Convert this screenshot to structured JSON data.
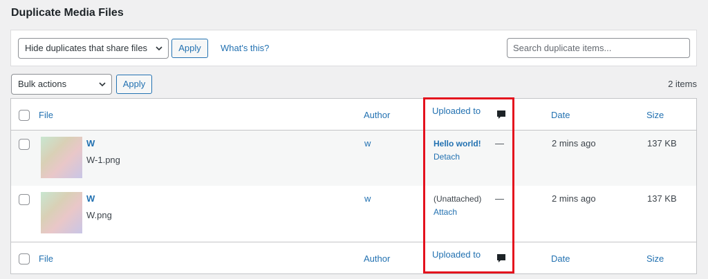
{
  "page": {
    "title": "Duplicate Media Files"
  },
  "filter": {
    "select_value": "Hide duplicates that share files",
    "apply_label": "Apply",
    "whats_this": "What's this?",
    "search_placeholder": "Search duplicate items..."
  },
  "bulk": {
    "select_value": "Bulk actions",
    "apply_label": "Apply",
    "item_count": "2 items"
  },
  "table": {
    "columns": {
      "file": "File",
      "author": "Author",
      "uploaded_to": "Uploaded to",
      "date": "Date",
      "size": "Size",
      "comments_icon": "comment-bubble-icon"
    },
    "rows": [
      {
        "title": "W",
        "filename": "W-1.png",
        "author": "w",
        "uploaded_to": "Hello world!",
        "uploaded_action": "Detach",
        "comments": "—",
        "date": "2 mins ago",
        "size": "137 KB"
      },
      {
        "title": "W",
        "filename": "W.png",
        "author": "w",
        "uploaded_to": "(Unattached)",
        "uploaded_action": "Attach",
        "comments": "—",
        "date": "2 mins ago",
        "size": "137 KB"
      }
    ]
  },
  "colors": {
    "accent": "#2271b1",
    "highlight_border": "#e4111d",
    "background": "#f0f0f1"
  }
}
